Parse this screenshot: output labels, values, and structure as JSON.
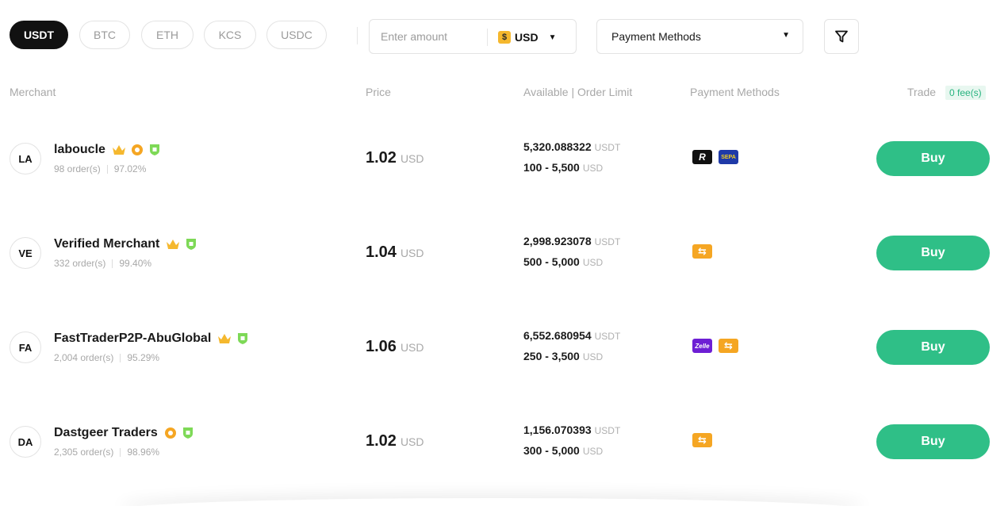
{
  "coins": [
    "USDT",
    "BTC",
    "ETH",
    "KCS",
    "USDC"
  ],
  "active_coin": "USDT",
  "amount": {
    "placeholder": "Enter amount",
    "currency_symbol": "$",
    "currency": "USD"
  },
  "payment_filter": {
    "label": "Payment Methods"
  },
  "icons": {
    "filter": "filter-funnel-icon",
    "caret": "caret-down-icon"
  },
  "columns": {
    "merchant": "Merchant",
    "price": "Price",
    "available": "Available | Order Limit",
    "payment": "Payment Methods",
    "trade": "Trade",
    "fee_badge": "0 fee(s)"
  },
  "colors": {
    "buy": "#2fbf87",
    "accent_gold": "#f5b82e",
    "verified": "#7ed957"
  },
  "rows": [
    {
      "initials": "LA",
      "name": "laboucle",
      "orders": "98 order(s)",
      "completion": "97.02%",
      "badges": [
        "crown-icon",
        "gold-badge-icon",
        "shield-verified-icon"
      ],
      "price": "1.02",
      "price_unit": "USD",
      "available": "5,320.088322",
      "available_unit": "USDT",
      "limit": "100 - 5,500",
      "limit_unit": "USD",
      "payments": [
        {
          "icon": "revolut-icon",
          "glyph": "R"
        },
        {
          "icon": "sepa-icon",
          "glyph": "SEPA"
        }
      ],
      "buy_label": "Buy"
    },
    {
      "initials": "VE",
      "name": "Verified Merchant",
      "orders": "332 order(s)",
      "completion": "99.40%",
      "badges": [
        "crown-icon",
        "shield-verified-icon"
      ],
      "price": "1.04",
      "price_unit": "USD",
      "available": "2,998.923078",
      "available_unit": "USDT",
      "limit": "500 - 5,000",
      "limit_unit": "USD",
      "payments": [
        {
          "icon": "bank-transfer-icon",
          "glyph": "⇆"
        }
      ],
      "buy_label": "Buy"
    },
    {
      "initials": "FA",
      "name": "FastTraderP2P-AbuGlobal",
      "orders": "2,004 order(s)",
      "completion": "95.29%",
      "badges": [
        "crown-icon",
        "shield-verified-icon"
      ],
      "price": "1.06",
      "price_unit": "USD",
      "available": "6,552.680954",
      "available_unit": "USDT",
      "limit": "250 - 3,500",
      "limit_unit": "USD",
      "payments": [
        {
          "icon": "zelle-icon",
          "glyph": "Zelle"
        },
        {
          "icon": "bank-transfer-icon",
          "glyph": "⇆"
        }
      ],
      "buy_label": "Buy"
    },
    {
      "initials": "DA",
      "name": "Dastgeer Traders",
      "orders": "2,305 order(s)",
      "completion": "98.96%",
      "badges": [
        "gold-badge-icon",
        "shield-verified-icon"
      ],
      "price": "1.02",
      "price_unit": "USD",
      "available": "1,156.070393",
      "available_unit": "USDT",
      "limit": "300 - 5,000",
      "limit_unit": "USD",
      "payments": [
        {
          "icon": "bank-transfer-icon",
          "glyph": "⇆"
        }
      ],
      "buy_label": "Buy"
    }
  ]
}
